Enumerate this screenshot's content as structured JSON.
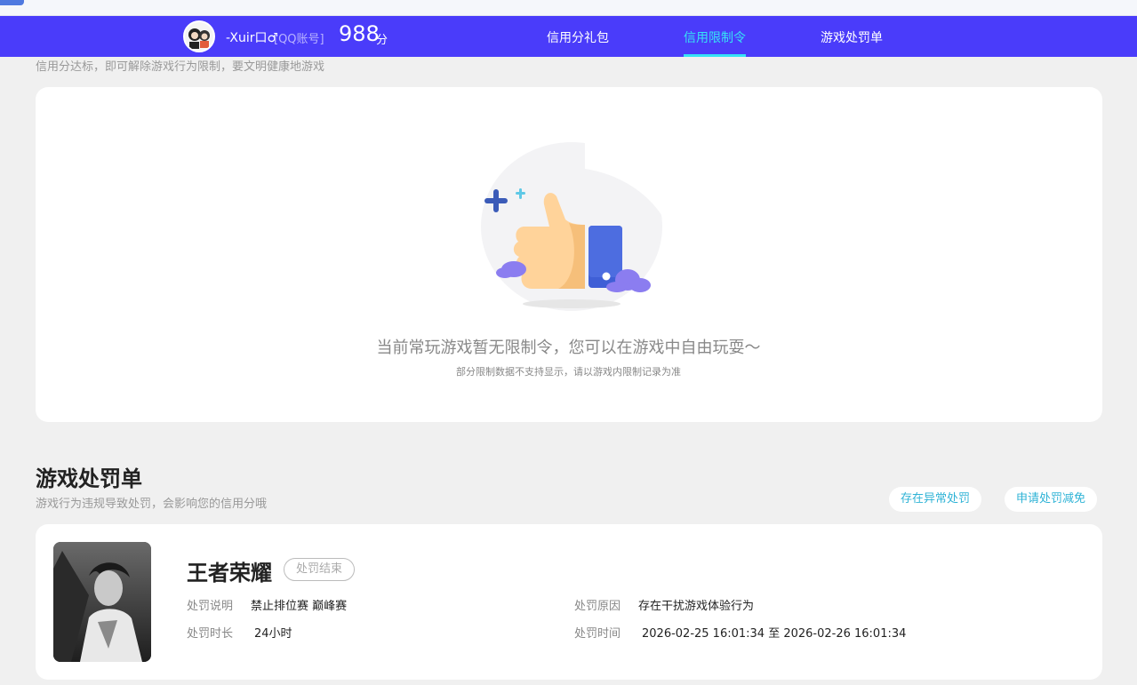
{
  "header": {
    "username": "-Xuir口♂",
    "account_type": "[QQ账号]",
    "score": "988",
    "score_unit": "分",
    "tabs": [
      {
        "label": "信用分礼包",
        "active": false
      },
      {
        "label": "信用限制令",
        "active": true
      },
      {
        "label": "游戏处罚单",
        "active": false
      }
    ]
  },
  "restriction": {
    "intro": "信用分达标，即可解除游戏行为限制，要文明健康地游戏",
    "empty_title": "当前常玩游戏暂无限制令，您可以在游戏中自由玩耍～",
    "empty_note": "部分限制数据不支持显示，请以游戏内限制记录为准"
  },
  "penalty": {
    "title": "游戏处罚单",
    "subtitle": "游戏行为违规导致处罚，会影响您的信用分哦",
    "buttons": {
      "anomaly": "存在异常处罚",
      "appeal": "申请处罚减免"
    },
    "items": [
      {
        "game": "王者荣耀",
        "status": "处罚结束",
        "desc_label": "处罚说明",
        "desc_value": "禁止排位赛 巅峰赛",
        "duration_label": "处罚时长",
        "duration_value": "24小时",
        "reason_label": "处罚原因",
        "reason_value": "存在干扰游戏体验行为",
        "time_label": "处罚时间",
        "time_value": "2026-02-25 16:01:34 至 2026-02-26 16:01:34"
      }
    ]
  },
  "colors": {
    "topbar": "#4a3cfa",
    "active_tab": "#36e3f5",
    "accent_button_text": "#2fb3d6"
  }
}
